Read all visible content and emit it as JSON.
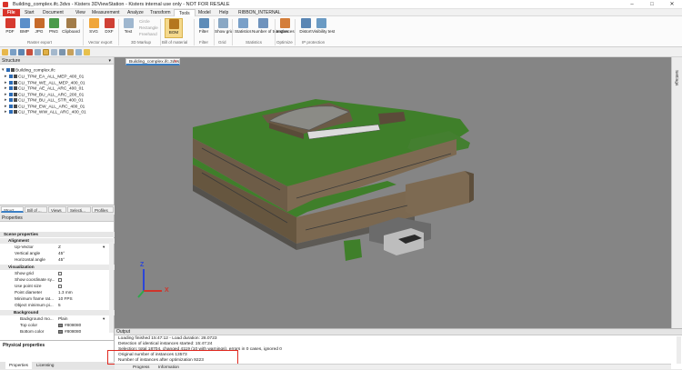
{
  "window": {
    "title": "Building_complex.ifc.3dvs - Kisters 3DViewStation - Kisters internal use only - NOT FOR RESALE"
  },
  "menu": {
    "tabs": [
      "File",
      "Start",
      "Document",
      "View",
      "Measurement",
      "Analyze",
      "Transform",
      "Tools",
      "Model",
      "Help",
      "RIBBON_INTERNAL"
    ],
    "active": "Tools"
  },
  "ribbon": {
    "raster": {
      "buttons": [
        "PDF",
        "BMP",
        "JPG",
        "PNG",
        "Clipboard"
      ],
      "label": "Raster export"
    },
    "vector": {
      "buttons": [
        "SVG",
        "DXF"
      ],
      "label": "Vector export"
    },
    "markup": {
      "buttons": [
        "Text",
        "Circle",
        "Rectangle",
        "Freehand"
      ],
      "label": "3D Markup"
    },
    "bom": {
      "buttons": [
        "BOM"
      ],
      "label": "Bill of material"
    },
    "filter": {
      "buttons": [
        "Filter"
      ],
      "label": "Filter"
    },
    "grid": {
      "buttons": [
        "Show grid"
      ],
      "label": "Grid"
    },
    "statistics": {
      "buttons": [
        "Statistics",
        "Number of triangles"
      ],
      "label": "Statistics"
    },
    "optimize": {
      "buttons": [
        "Instances"
      ],
      "label": "Optimize"
    },
    "ip": {
      "buttons": [
        "Distort",
        "Visibility test"
      ],
      "label": "IP protection"
    }
  },
  "structure": {
    "title": "Structure",
    "root": "Building_complex.ifc",
    "items": [
      "CLI_TPM_EA_ALL_MEP_400_01",
      "CLI_TPM_WE_ALL_MEP_400_01",
      "CLI_TPM_AE_ALL_ARC_400_01",
      "CLI_TPM_BU_ALL_ARC_200_01",
      "CLI_TPM_BU_ALL_STR_400_01",
      "CLI_TPM_EW_ALL_ARC_400_01",
      "CLI_TPM_WW_ALL_ARC_400_01"
    ],
    "tabs": [
      "Struct...",
      "Bill of ...",
      "Views",
      "Selecti...",
      "Profiles"
    ]
  },
  "properties": {
    "title": "Properties",
    "scene": "Scene properties",
    "alignment_header": "Alignment",
    "alignment": [
      {
        "k": "Up-Vector",
        "v": "Z"
      },
      {
        "k": "Vertical angle",
        "v": "45°"
      },
      {
        "k": "Horizontal angle",
        "v": "45°"
      }
    ],
    "visualization_header": "Visualization",
    "visualization": [
      {
        "k": "Show grid",
        "v": ""
      },
      {
        "k": "Show coordinate sy...",
        "v": ""
      },
      {
        "k": "Use point size",
        "v": ""
      },
      {
        "k": "Point diameter",
        "v": "1.3 mm"
      },
      {
        "k": "Minimum frame rat...",
        "v": "10 FPS"
      },
      {
        "k": "Object minimum pi...",
        "v": "5"
      }
    ],
    "background_header": "Background",
    "background": [
      {
        "k": "Background mo...",
        "v": "Plain"
      },
      {
        "k": "Top color",
        "v": "#808080"
      },
      {
        "k": "Bottom color",
        "v": "#808080"
      }
    ],
    "physical": "Physical properties"
  },
  "bottom_tabs": [
    "Properties",
    "Licensing"
  ],
  "document_tab": "Building_complex.ifc.3dvs",
  "right_panel": "Settings",
  "axis": {
    "x": "X",
    "y": "Y",
    "z": "Z"
  },
  "output": {
    "title": "Output",
    "lines": [
      "Loading finished 15:47:12 - Load duration: 28.0723",
      "Detection of identical instances started: 15:47:24",
      "Selection: total 18704, changed 4119 (10 with warnings), errors in 0 cases, ignored 0",
      "Original number of instances 13573",
      "Number of instances after optimization 9223"
    ],
    "tabs": [
      "Progress",
      "Information"
    ]
  },
  "colors": {
    "accent": "#3b7fc4",
    "file_tab": "#d9342b",
    "highlight": "#e0281f",
    "viewport_bg": "#858585",
    "roof": "#3f7f2a",
    "wall": "#7d6a52"
  }
}
